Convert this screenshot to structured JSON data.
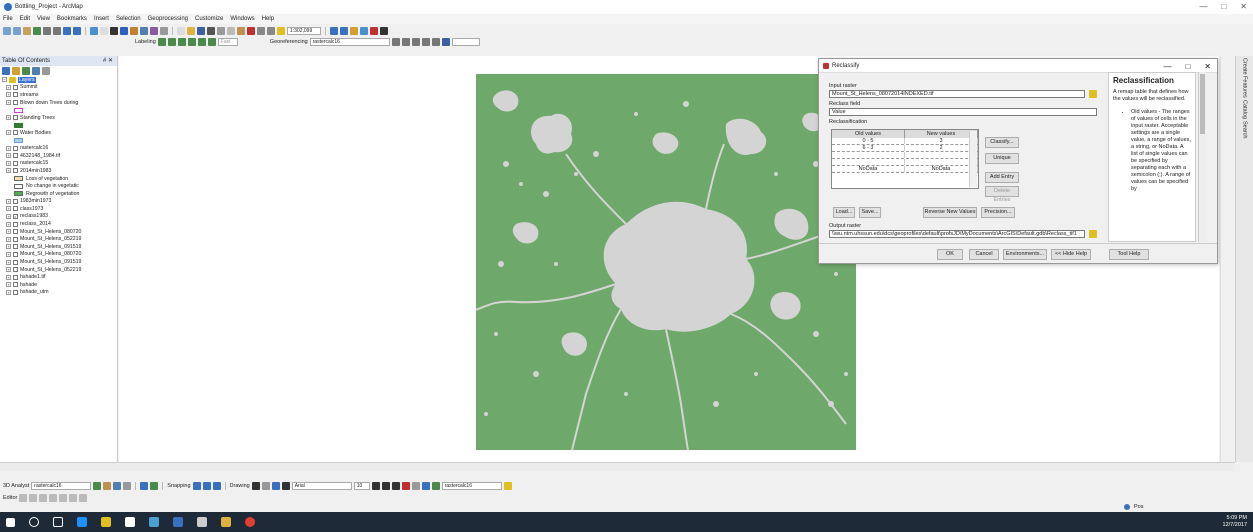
{
  "window": {
    "title": "Bottling_Project - ArcMap",
    "controls": [
      "—",
      "□",
      "✕"
    ]
  },
  "menu": [
    "File",
    "Edit",
    "View",
    "Bookmarks",
    "Insert",
    "Selection",
    "Geoprocessing",
    "Customize",
    "Windows",
    "Help"
  ],
  "toolbar": {
    "scale": "1:302,099",
    "labeling": "Labeling",
    "font": "Arial",
    "georeferencing": "Georeferencing",
    "georef_layer": "rastercalc16"
  },
  "toc": {
    "title": "Table Of Contents",
    "pin": "# ✕",
    "root": "Layers",
    "layers": [
      {
        "name": "Summit",
        "checked": false
      },
      {
        "name": "streams",
        "checked": false
      },
      {
        "name": "Blown down Trees during",
        "checked": false,
        "legend_color": "#ffffff",
        "legend_border": "#d040d0"
      },
      {
        "name": "Standing Trees",
        "checked": false,
        "legend_color": "#2e7d32",
        "legend_border": "#2e7d32"
      },
      {
        "name": "Water Bodies",
        "checked": false,
        "legend_color": "#a8d0f0",
        "legend_border": "#6aa0d0"
      },
      {
        "name": "rastercalc16",
        "checked": false
      },
      {
        "name": "4632148_1984.tif",
        "checked": false
      },
      {
        "name": "rastercalc15",
        "checked": false
      },
      {
        "name": "2014min1983",
        "checked": false
      }
    ],
    "change_legend": [
      {
        "label": "Loss of vegetation",
        "color": "#f5deb3"
      },
      {
        "label": "No change in vegetatic",
        "color": "#ffffff"
      },
      {
        "label": "Regrowth of vegetation",
        "color": "#4caf50"
      }
    ],
    "more_layers": [
      {
        "name": "1983min1973",
        "checked": false
      },
      {
        "name": "class1973",
        "checked": false
      },
      {
        "name": "reclass1983",
        "checked": true
      },
      {
        "name": "reclass_2014",
        "checked": false
      },
      {
        "name": "Mount_St_Helens_080720",
        "checked": false
      },
      {
        "name": "Mount_St_Helens_052219",
        "checked": false
      },
      {
        "name": "Mount_St_Helens_091519",
        "checked": false
      },
      {
        "name": "Mount_St_Helens_080720",
        "checked": false
      },
      {
        "name": "Mount_St_Helens_091519",
        "checked": false
      },
      {
        "name": "Mount_St_Helens_052219",
        "checked": false
      },
      {
        "name": "hshade1.tif",
        "checked": false
      },
      {
        "name": "hshade",
        "checked": false
      },
      {
        "name": "hshade_utm",
        "checked": false
      }
    ]
  },
  "map": {
    "land_color": "#6fa86b",
    "feature_color": "#d4d4d4"
  },
  "dialog": {
    "title": "Reclassify",
    "input_raster_label": "Input raster",
    "input_raster_value": "Mount_St_Helens_08072014INDEXED.tif",
    "reclass_field_label": "Reclass field",
    "reclass_field_value": "Value",
    "reclassification_label": "Reclassification",
    "table_headers": [
      "Old values",
      "New values"
    ],
    "table_rows": [
      {
        "old": "0 - 5",
        "new": "3"
      },
      {
        "old": "6 - 3",
        "new": "2"
      },
      {
        "old": "",
        "new": ""
      },
      {
        "old": "",
        "new": ""
      },
      {
        "old": "NoData",
        "new": "NoData"
      }
    ],
    "side_buttons": [
      "Classify...",
      "Unique",
      "Add Entry",
      "Delete Entries"
    ],
    "bottom_buttons": [
      "Load...",
      "Save...",
      "Reverse New Values",
      "Precision..."
    ],
    "output_raster_label": "Output raster",
    "output_raster_value": "\\\\wu.ntm.uhssun.edu\\dcs\\geoprofiles\\default\\profsJD\\MyDocuments\\ArcGIS\\Default.gdb\\Reclass_tif1",
    "footer_buttons": [
      "OK",
      "Cancel",
      "Environments...",
      "<< Hide Help",
      "Tool Help"
    ]
  },
  "help": {
    "title": "Reclassification",
    "intro": "A remap table that defines how the values will be reclassified.",
    "bullet": "Old values - The ranges of values of cells in the input raster. Acceptable settings are a single value, a range of values, a string, or NoData. A list of single values can be specified by separating each with a semicolon (;). A range of values can be specified by"
  },
  "bottom": {
    "analyst": "3D Analyst",
    "analyst_layer": "rastercalc16",
    "snapping": "Snapping",
    "drawing": "Drawing",
    "draw_font": "Arial",
    "draw_size": "10",
    "draw_layer": "rastercalc16",
    "editor": "Editor"
  },
  "status": {
    "text": "Pos"
  },
  "dock": [
    "Create Features",
    "Catalog",
    "Search"
  ],
  "clock": {
    "time": "5:09 PM",
    "date": "12/7/2017"
  }
}
